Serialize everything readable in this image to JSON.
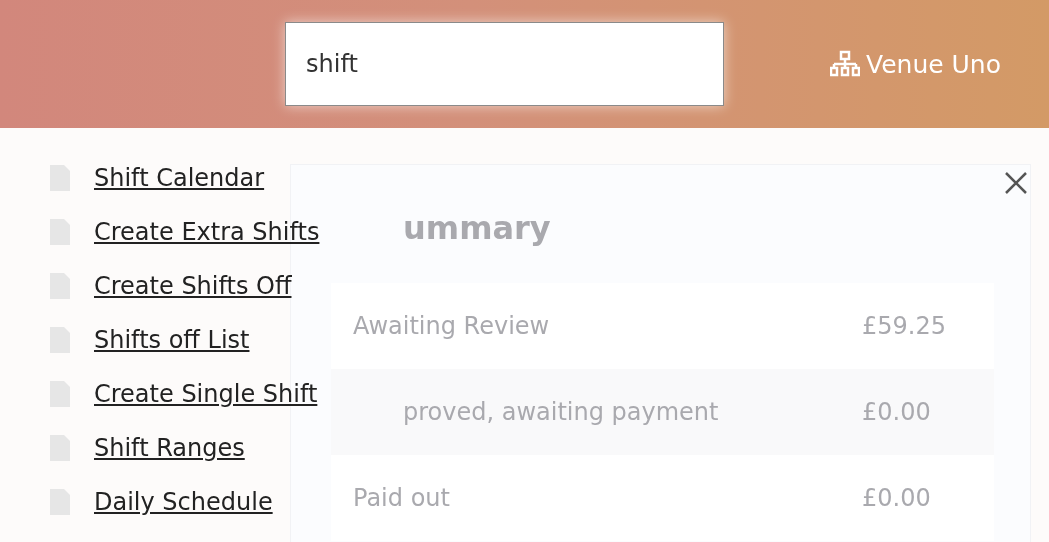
{
  "header": {
    "search": {
      "value": "shift"
    },
    "venue": "Venue Uno"
  },
  "results": [
    {
      "label": "Shift Calendar"
    },
    {
      "label": "Create Extra Shifts"
    },
    {
      "label": "Create Shifts Off"
    },
    {
      "label": "Shifts off List"
    },
    {
      "label": "Create Single Shift"
    },
    {
      "label": "Shift Ranges"
    },
    {
      "label": "Daily Schedule"
    }
  ],
  "summary": {
    "title": "ummary",
    "rows": [
      {
        "label": "Awaiting Review",
        "amount": "£59.25"
      },
      {
        "label": "proved, awaiting payment",
        "amount": "£0.00"
      },
      {
        "label": "Paid out",
        "amount": "£0.00"
      }
    ]
  }
}
